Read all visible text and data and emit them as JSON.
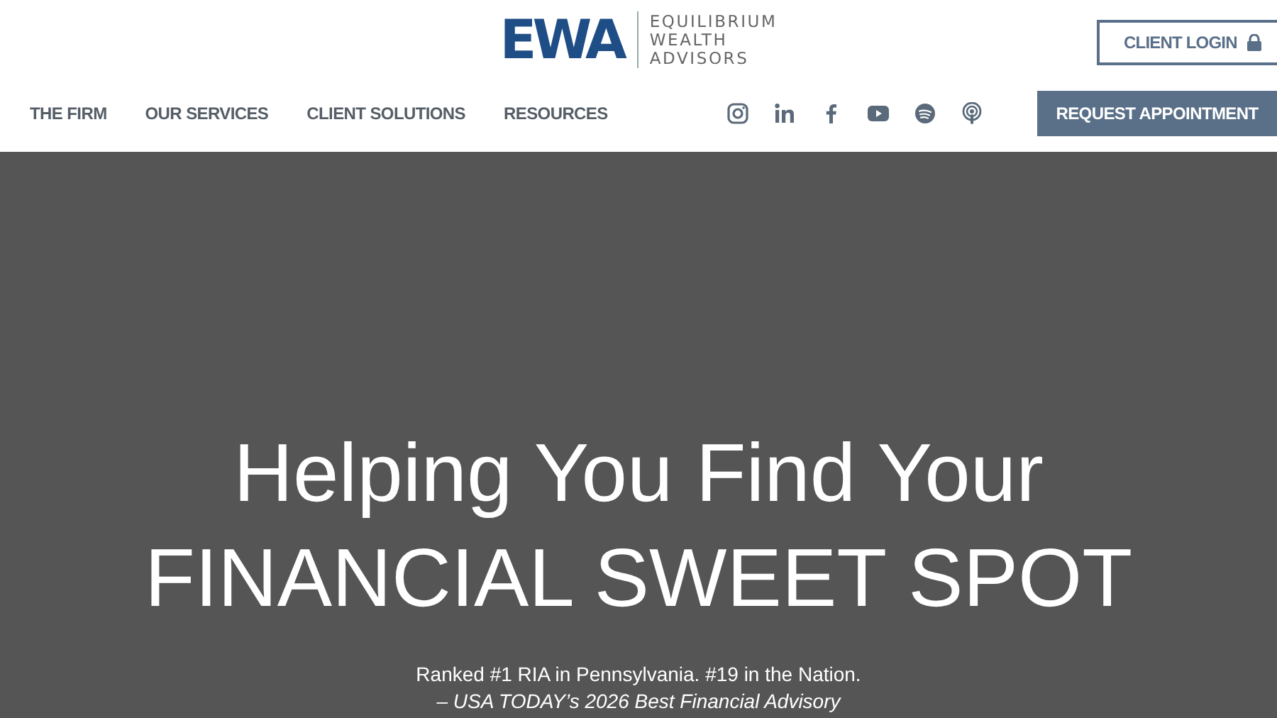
{
  "header": {
    "logo": {
      "mark": "EWA",
      "name_lines": [
        "EQUILIBRIUM",
        "WEALTH",
        "ADVISORS"
      ]
    },
    "client_login": {
      "label": "CLIENT LOGIN"
    },
    "nav": [
      {
        "label": "THE FIRM"
      },
      {
        "label": "OUR SERVICES"
      },
      {
        "label": "CLIENT SOLUTIONS"
      },
      {
        "label": "RESOURCES"
      }
    ],
    "social": [
      {
        "kind": "instagram"
      },
      {
        "kind": "linkedin"
      },
      {
        "kind": "facebook"
      },
      {
        "kind": "youtube"
      },
      {
        "kind": "spotify"
      },
      {
        "kind": "podcast"
      }
    ],
    "cta": {
      "label": "REQUEST APPOINTMENT"
    }
  },
  "hero": {
    "title_lines": [
      "Helping You Find Your",
      "FINANCIAL SWEET SPOT"
    ],
    "ranking": "Ranked #1 RIA in Pennsylvania. #19 in the Nation.",
    "source": "– USA TODAY’s 2026 Best Financial Advisory"
  }
}
